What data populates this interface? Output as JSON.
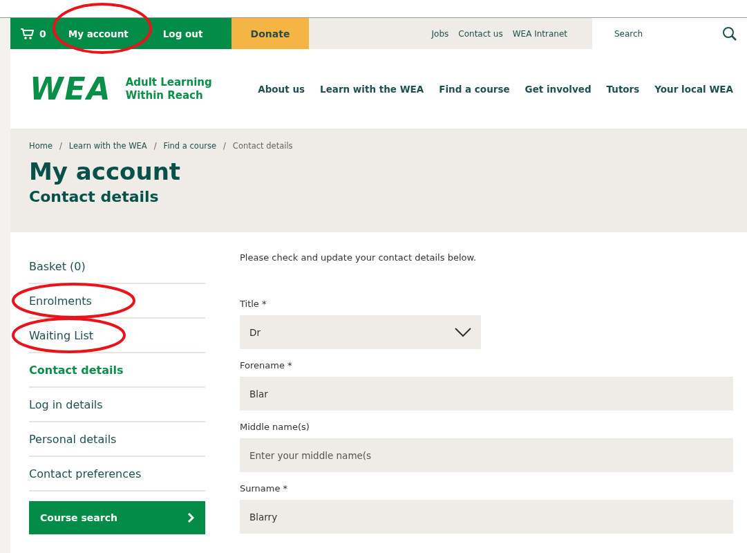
{
  "top_bar": {
    "basket_count": "0",
    "links": [
      {
        "label": "My account",
        "circled": true
      },
      {
        "label": "Log out",
        "circled": false
      }
    ],
    "donate": "Donate",
    "utility_links": [
      "Jobs",
      "Contact us",
      "WEA Intranet"
    ],
    "search": {
      "placeholder": "Search"
    }
  },
  "header": {
    "logo": "WEA",
    "tagline": [
      "Adult Learning",
      "Within Reach"
    ],
    "nav": [
      "About us",
      "Learn with the WEA",
      "Find a course",
      "Get involved",
      "Tutors",
      "Your local WEA"
    ]
  },
  "breadcrumb": [
    {
      "label": "Home"
    },
    {
      "separator": "/",
      "label": "Learn with the WEA"
    },
    {
      "separator": "/",
      "label": "Find a course"
    },
    {
      "separator": "/",
      "label": "Contact details"
    }
  ],
  "page_title": "My account",
  "page_subtitle": "Contact details",
  "sidebar": {
    "items": [
      {
        "label": "Basket (0)",
        "selected": false,
        "circled": false
      },
      {
        "label": "Enrolments",
        "selected": false,
        "circled": true
      },
      {
        "label": "Waiting List",
        "selected": false,
        "circled": true
      },
      {
        "label": "Contact details",
        "selected": true,
        "circled": false
      },
      {
        "label": "Log in details",
        "selected": false,
        "circled": false
      },
      {
        "label": "Personal details",
        "selected": false,
        "circled": false
      },
      {
        "label": "Contact preferences",
        "selected": false,
        "circled": false
      }
    ],
    "button": "Course search"
  },
  "form": {
    "intro": "Please check and update your contact details below.",
    "fields": [
      {
        "kind": "select",
        "label": "Title *",
        "value": "Dr"
      },
      {
        "kind": "text",
        "label": "Forename *",
        "value": "Blar"
      },
      {
        "kind": "text",
        "label": "Middle name(s)",
        "placeholder": "Enter your middle name(s"
      },
      {
        "kind": "text",
        "label": "Surname *",
        "value": "Blarry"
      }
    ]
  }
}
